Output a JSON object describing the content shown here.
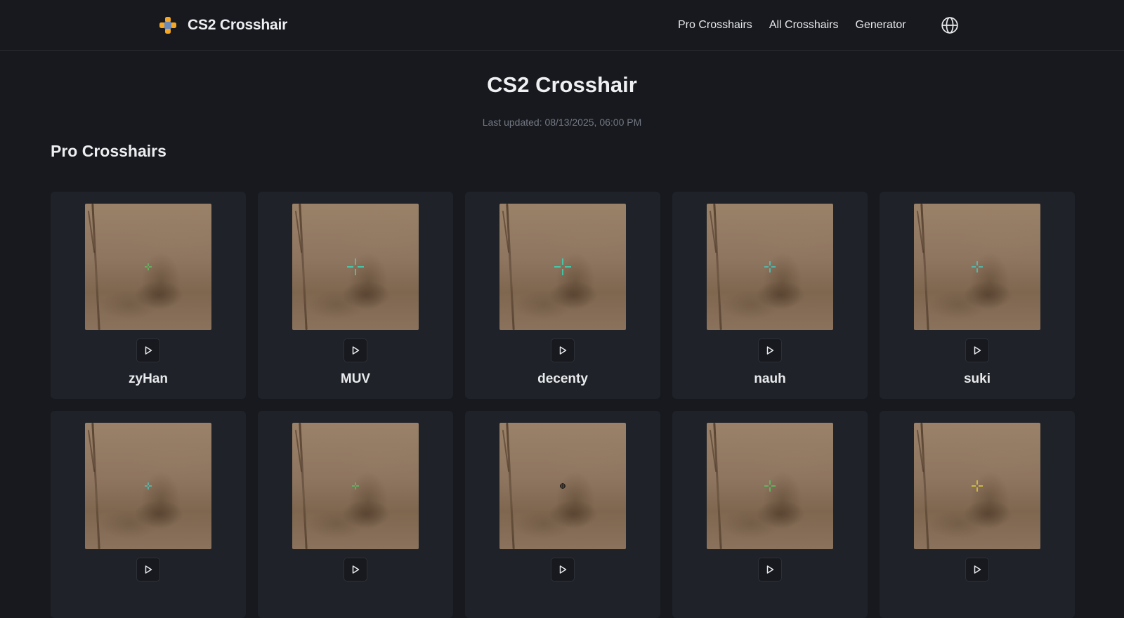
{
  "header": {
    "brand": "CS2 Crosshair",
    "nav": [
      "Pro Crosshairs",
      "All Crosshairs",
      "Generator"
    ]
  },
  "main": {
    "title": "CS2 Crosshair",
    "updated": "Last updated: 08/13/2025, 06:00 PM",
    "section_title": "Pro Crosshairs"
  },
  "cards": [
    {
      "name": "zyHan",
      "color": "#4cd964",
      "style": "small"
    },
    {
      "name": "MUV",
      "color": "#2ee6c4",
      "style": "large"
    },
    {
      "name": "decenty",
      "color": "#2ee6c4",
      "style": "large"
    },
    {
      "name": "nauh",
      "color": "#38e0d8",
      "style": "medium"
    },
    {
      "name": "suki",
      "color": "#38e0d8",
      "style": "medium"
    },
    {
      "name": "",
      "color": "#38e0d8",
      "style": "small"
    },
    {
      "name": "",
      "color": "#4cd964",
      "style": "small"
    },
    {
      "name": "",
      "color": "#1a1a1a",
      "style": "dot"
    },
    {
      "name": "",
      "color": "#4cd964",
      "style": "medium"
    },
    {
      "name": "",
      "color": "#f2e233",
      "style": "medium"
    }
  ]
}
